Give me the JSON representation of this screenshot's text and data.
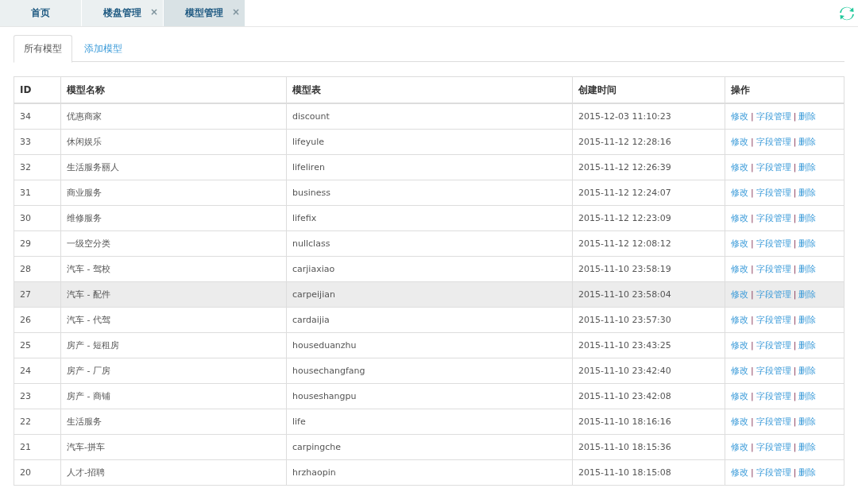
{
  "top_tabs": [
    {
      "label": "首页",
      "selected": false
    },
    {
      "label": "楼盘管理",
      "selected": false,
      "close": "×"
    },
    {
      "label": "模型管理",
      "selected": true,
      "close": "×"
    }
  ],
  "sub_tabs": [
    {
      "label": "所有模型",
      "selected": true
    },
    {
      "label": "添加模型",
      "selected": false
    }
  ],
  "table": {
    "columns": [
      "ID",
      "模型名称",
      "模型表",
      "创建时间",
      "操作"
    ],
    "rows": [
      {
        "cells": [
          "34",
          "优惠商家",
          "discount",
          "2015-12-03 11:10:23"
        ],
        "actions": [
          "修改",
          "|",
          "字段管理",
          "|",
          "删除"
        ],
        "highlighted": false
      },
      {
        "cells": [
          "33",
          "休闲娱乐",
          "lifeyule",
          "2015-11-12 12:28:16"
        ],
        "actions": [
          "修改",
          "|",
          "字段管理",
          "|",
          "删除"
        ],
        "highlighted": false
      },
      {
        "cells": [
          "32",
          "生活服务丽人",
          "lifeliren",
          "2015-11-12 12:26:39"
        ],
        "actions": [
          "修改",
          "|",
          "字段管理",
          "|",
          "删除"
        ],
        "highlighted": false
      },
      {
        "cells": [
          "31",
          "商业服务",
          "business",
          "2015-11-12 12:24:07"
        ],
        "actions": [
          "修改",
          "|",
          "字段管理",
          "|",
          "删除"
        ],
        "highlighted": false
      },
      {
        "cells": [
          "30",
          "维修服务",
          "lifefix",
          "2015-11-12 12:23:09"
        ],
        "actions": [
          "修改",
          "|",
          "字段管理",
          "|",
          "删除"
        ],
        "highlighted": false
      },
      {
        "cells": [
          "29",
          "一级空分类",
          "nullclass",
          "2015-11-12 12:08:12"
        ],
        "actions": [
          "修改",
          "|",
          "字段管理",
          "|",
          "删除"
        ],
        "highlighted": false
      },
      {
        "cells": [
          "28",
          "汽车 - 驾校",
          "carjiaxiao",
          "2015-11-10 23:58:19"
        ],
        "actions": [
          "修改",
          "|",
          "字段管理",
          "|",
          "删除"
        ],
        "highlighted": false
      },
      {
        "cells": [
          "27",
          "汽车 - 配件",
          "carpeijian",
          "2015-11-10 23:58:04"
        ],
        "actions": [
          "修改",
          "|",
          "字段管理",
          "|",
          "删除"
        ],
        "highlighted": true
      },
      {
        "cells": [
          "26",
          "汽车 - 代驾",
          "cardaijia",
          "2015-11-10 23:57:30"
        ],
        "actions": [
          "修改",
          "|",
          "字段管理",
          "|",
          "删除"
        ],
        "highlighted": false
      },
      {
        "cells": [
          "25",
          "房产 - 短租房",
          "houseduanzhu",
          "2015-11-10 23:43:25"
        ],
        "actions": [
          "修改",
          "|",
          "字段管理",
          "|",
          "删除"
        ],
        "highlighted": false
      },
      {
        "cells": [
          "24",
          "房产 - 厂房",
          "housechangfang",
          "2015-11-10 23:42:40"
        ],
        "actions": [
          "修改",
          "|",
          "字段管理",
          "|",
          "删除"
        ],
        "highlighted": false
      },
      {
        "cells": [
          "23",
          "房产 - 商铺",
          "houseshangpu",
          "2015-11-10 23:42:08"
        ],
        "actions": [
          "修改",
          "|",
          "字段管理",
          "|",
          "删除"
        ],
        "highlighted": false
      },
      {
        "cells": [
          "22",
          "生活服务",
          "life",
          "2015-11-10 18:16:16"
        ],
        "actions": [
          "修改",
          "|",
          "字段管理",
          "|",
          "删除"
        ],
        "highlighted": false
      },
      {
        "cells": [
          "21",
          "汽车-拼车",
          "carpingche",
          "2015-11-10 18:15:36"
        ],
        "actions": [
          "修改",
          "|",
          "字段管理",
          "|",
          "删除"
        ],
        "highlighted": false
      },
      {
        "cells": [
          "20",
          "人才-招聘",
          "hrzhaopin",
          "2015-11-10 18:15:08"
        ],
        "actions": [
          "修改",
          "|",
          "字段管理",
          "|",
          "删除"
        ],
        "highlighted": false
      }
    ]
  }
}
